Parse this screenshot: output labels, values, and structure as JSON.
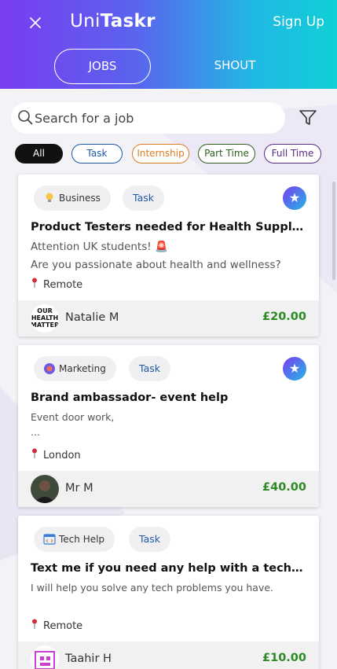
{
  "header": {
    "brand_part1": "Uni",
    "brand_part2": "Taskr",
    "signup_label": "Sign Up",
    "tabs": [
      {
        "label": "JOBS"
      },
      {
        "label": "SHOUT"
      }
    ],
    "colors": {
      "gradient_start": "#7a3cf0",
      "gradient_end": "#0fd0d6"
    }
  },
  "search": {
    "placeholder": "Search for a job",
    "value": ""
  },
  "filters": [
    {
      "label": "All"
    },
    {
      "label": "Task"
    },
    {
      "label": "Internship"
    },
    {
      "label": "Part Time"
    },
    {
      "label": "Full Time"
    }
  ],
  "jobs": [
    {
      "category": "Business",
      "category_icon": "lightbulb-icon",
      "type": "Task",
      "featured": true,
      "title": "Product Testers needed for Health Supplement Company",
      "desc1": "Attention UK students! 🚨",
      "desc2": "Are you passionate about health and wellness?",
      "location": "Remote",
      "poster": "Natalie M",
      "price": "£20.00"
    },
    {
      "category": "Marketing",
      "category_icon": "marketing-icon",
      "type": "Task",
      "featured": true,
      "title": "Brand ambassador- event help",
      "desc1": "Event door work,",
      "desc2": "...",
      "location": "London",
      "poster": "Mr M",
      "price": "£40.00"
    },
    {
      "category": "Tech Help",
      "category_icon": "code-window-icon",
      "type": "Task",
      "featured": false,
      "title": "Text me if you need any help with a tech task",
      "desc1": "I will help you solve any tech problems you have.",
      "desc2": "",
      "location": "Remote",
      "poster": "Taahir H",
      "price": "£10.00"
    }
  ]
}
